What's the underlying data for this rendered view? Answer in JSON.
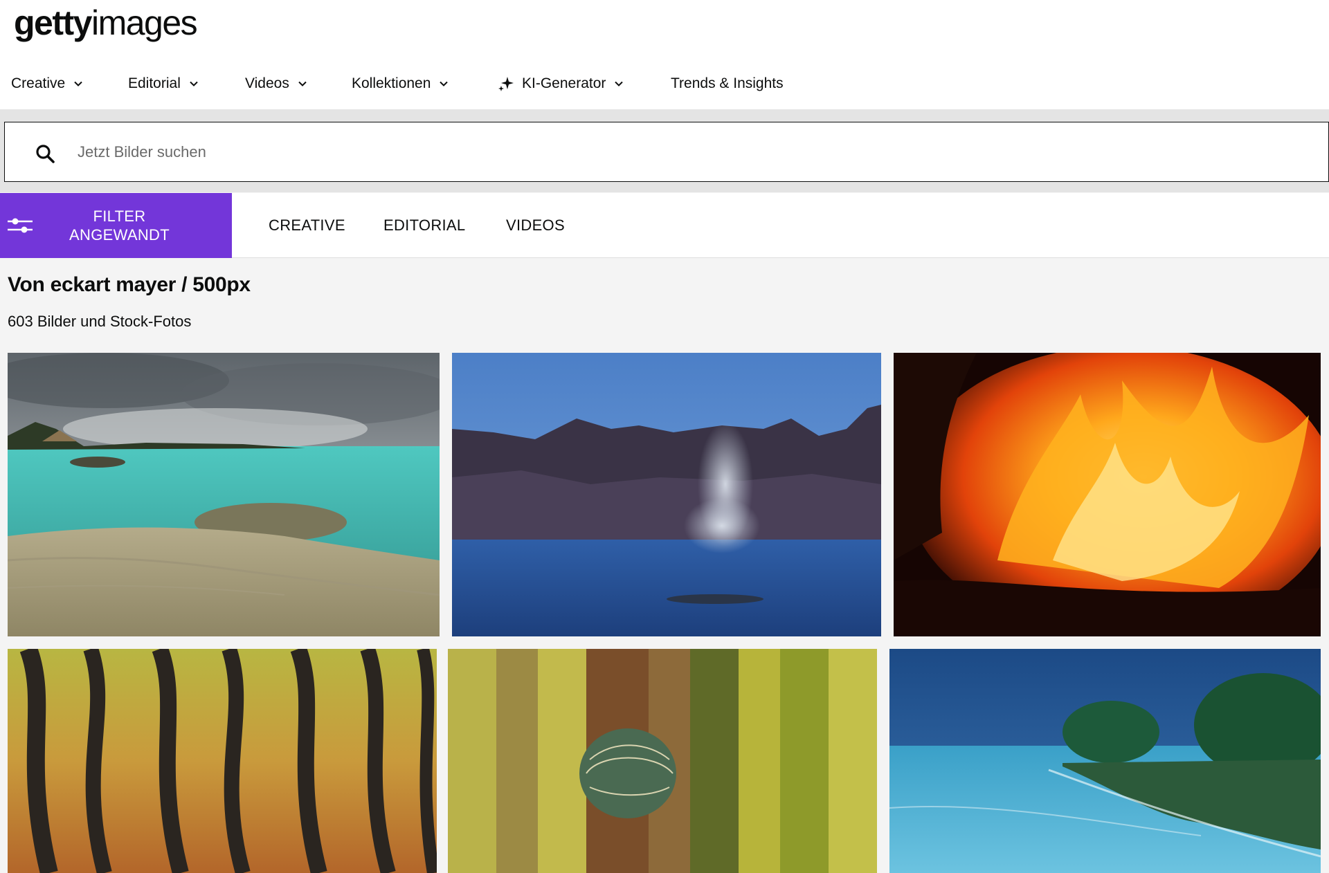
{
  "brand": {
    "logo_bold": "getty",
    "logo_light": "images"
  },
  "nav": {
    "items": [
      {
        "label": "Creative",
        "icon": "chevron-down-icon"
      },
      {
        "label": "Editorial",
        "icon": "chevron-down-icon"
      },
      {
        "label": "Videos",
        "icon": "chevron-down-icon"
      },
      {
        "label": "Kollektionen",
        "icon": "chevron-down-icon"
      },
      {
        "label": "KI-Generator",
        "icon": "chevron-down-icon",
        "leading_icon": "sparkle-icon"
      },
      {
        "label": "Trends & Insights"
      }
    ]
  },
  "search": {
    "placeholder": "Jetzt Bilder suchen",
    "value": "",
    "icon": "search-icon"
  },
  "filter": {
    "line1": "FILTER",
    "line2": "ANGEWANDT",
    "icon": "sliders-icon",
    "accent_color": "#7336d9"
  },
  "asset_tabs": [
    "CREATIVE",
    "EDITORIAL",
    "VIDEOS"
  ],
  "results": {
    "title": "Von eckart mayer / 500px",
    "count_text": "603 Bilder und Stock-Fotos"
  },
  "photos": [
    {
      "subject": "turquoise lagoon shoreline with cloudy sky"
    },
    {
      "subject": "whale spout in front of mountains"
    },
    {
      "subject": "close-up of burning fire"
    },
    {
      "subject": "cactus spines close-up"
    },
    {
      "subject": "small round cactus between cactus stems"
    },
    {
      "subject": "tropical coast with trees and blue sea"
    }
  ]
}
